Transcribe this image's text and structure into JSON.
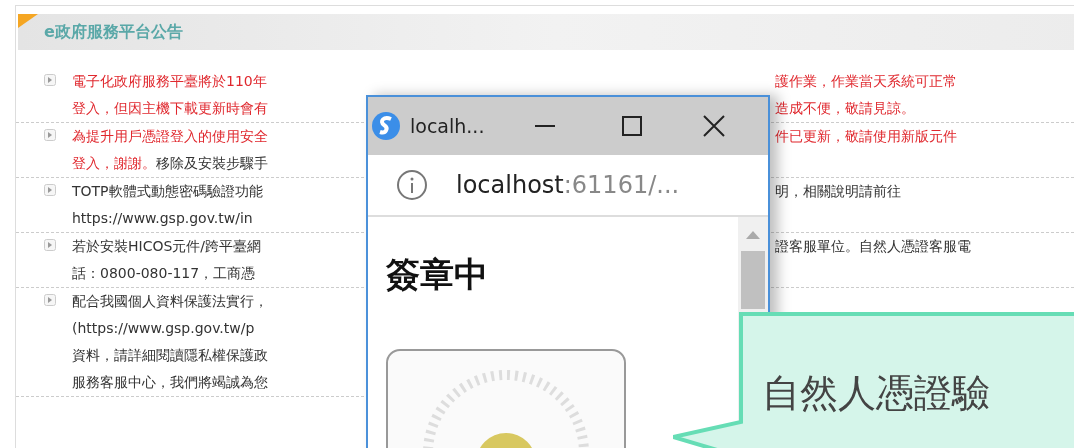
{
  "board": {
    "title": "e政府服務平台公告",
    "notices": [
      {
        "lines": [
          {
            "left": [
              {
                "text": "電子化政府服務平臺將於110年",
                "highlight": true
              }
            ],
            "right": [
              {
                "text": "護作業，作業當天系統可正常",
                "highlight": true
              }
            ]
          },
          {
            "left": [
              {
                "text": "登入，但因主機下載更新時會有",
                "highlight": true
              }
            ],
            "right": [
              {
                "text": "造成不便，敬請見諒。",
                "highlight": true
              }
            ]
          }
        ]
      },
      {
        "lines": [
          {
            "left": [
              {
                "text": "為提升用戶憑證登入的使用安全",
                "highlight": true
              }
            ],
            "right": [
              {
                "text": "件已更新，敬請使用新版元件",
                "highlight": true
              }
            ]
          },
          {
            "left": [
              {
                "text": "登入，謝謝。",
                "highlight": true
              },
              {
                "text": "移除及安裝步驟手",
                "highlight": false
              }
            ]
          }
        ]
      },
      {
        "lines": [
          {
            "left": [
              {
                "text": "TOTP軟體式動態密碼驗證功能",
                "highlight": false
              }
            ],
            "right": [
              {
                "text": "明，相關說明請前往",
                "highlight": false
              }
            ]
          },
          {
            "left": [
              {
                "text": "https://www.gsp.gov.tw/in",
                "highlight": false
              }
            ]
          }
        ]
      },
      {
        "lines": [
          {
            "left": [
              {
                "text": "若於安裝HICOS元件/跨平臺網",
                "highlight": false
              }
            ],
            "right": [
              {
                "text": "證客服單位。自然人憑證客服電",
                "highlight": false
              }
            ]
          },
          {
            "left": [
              {
                "text": "話：0800-080-117，工商憑",
                "highlight": false
              }
            ]
          }
        ]
      },
      {
        "lines": [
          {
            "left": [
              {
                "text": "配合我國個人資料保護法實行，",
                "highlight": false
              }
            ]
          },
          {
            "left": [
              {
                "text": "(https://www.gsp.gov.tw/p",
                "highlight": false
              }
            ]
          },
          {
            "left": [
              {
                "text": "資料，請詳細閱讀隱私權保護政",
                "highlight": false
              }
            ]
          },
          {
            "left": [
              {
                "text": "服務客服中心，我們將竭誠為您",
                "highlight": false
              }
            ]
          }
        ]
      }
    ]
  },
  "popup": {
    "title": "localh...",
    "address_host": "localhost",
    "address_rest": ":61161/...",
    "heading": "簽章中"
  },
  "callout": {
    "text": "自然人憑證驗"
  }
}
